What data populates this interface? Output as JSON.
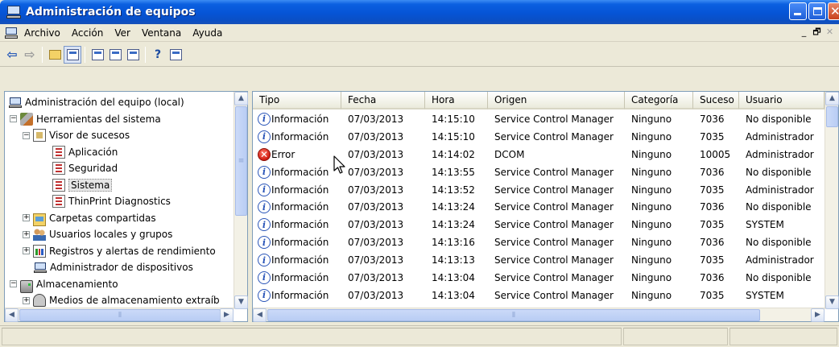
{
  "window": {
    "title": "Administración de equipos"
  },
  "menubar": {
    "items": [
      "Archivo",
      "Acción",
      "Ver",
      "Ventana",
      "Ayuda"
    ],
    "mdi_min": "_",
    "mdi_restore": "🗗",
    "mdi_close": "✕"
  },
  "toolbar": {
    "buttons": [
      "back-arrow-icon",
      "forward-arrow-icon",
      "up-folder-icon",
      "show-hide-tree-icon",
      "properties-icon",
      "refresh-icon",
      "export-list-icon",
      "help-icon",
      "show-hide-action-pane-icon"
    ]
  },
  "tree": {
    "items": [
      {
        "label": "Administración del equipo (local)",
        "icon": "computer-icon",
        "level": 0
      },
      {
        "label": "Herramientas del sistema",
        "icon": "system-tools-icon",
        "level": 1,
        "expander": "−"
      },
      {
        "label": "Visor de sucesos",
        "icon": "event-viewer-icon",
        "level": 2,
        "expander": "−"
      },
      {
        "label": "Aplicación",
        "icon": "event-log-icon",
        "level": 3
      },
      {
        "label": "Seguridad",
        "icon": "event-log-icon",
        "level": 3
      },
      {
        "label": "Sistema",
        "icon": "event-log-icon",
        "level": 3,
        "selected": true
      },
      {
        "label": "ThinPrint Diagnostics",
        "icon": "event-log-icon",
        "level": 3
      },
      {
        "label": "Carpetas compartidas",
        "icon": "shared-folder-icon",
        "level": 2,
        "expander": "+"
      },
      {
        "label": "Usuarios locales y grupos",
        "icon": "users-groups-icon",
        "level": 2,
        "expander": "+"
      },
      {
        "label": "Registros y alertas de rendimiento",
        "icon": "performance-icon",
        "level": 2,
        "expander": "+"
      },
      {
        "label": "Administrador de dispositivos",
        "icon": "device-manager-icon",
        "level": 2
      },
      {
        "label": "Almacenamiento",
        "icon": "storage-icon",
        "level": 1,
        "expander": "−"
      },
      {
        "label": "Medios de almacenamiento extraíb",
        "icon": "removable-storage-icon",
        "level": 2,
        "expander": "+"
      }
    ]
  },
  "events": {
    "columns": [
      "Tipo",
      "Fecha",
      "Hora",
      "Origen",
      "Categoría",
      "Suceso",
      "Usuario"
    ],
    "rows": [
      {
        "tipo": "Información",
        "level": "info",
        "fecha": "07/03/2013",
        "hora": "14:15:10",
        "origen": "Service Control Manager",
        "categoria": "Ninguno",
        "suceso": "7036",
        "usuario": "No disponible"
      },
      {
        "tipo": "Información",
        "level": "info",
        "fecha": "07/03/2013",
        "hora": "14:15:10",
        "origen": "Service Control Manager",
        "categoria": "Ninguno",
        "suceso": "7035",
        "usuario": "Administrador"
      },
      {
        "tipo": "Error",
        "level": "error",
        "fecha": "07/03/2013",
        "hora": "14:14:02",
        "origen": "DCOM",
        "categoria": "Ninguno",
        "suceso": "10005",
        "usuario": "Administrador"
      },
      {
        "tipo": "Información",
        "level": "info",
        "fecha": "07/03/2013",
        "hora": "14:13:55",
        "origen": "Service Control Manager",
        "categoria": "Ninguno",
        "suceso": "7036",
        "usuario": "No disponible"
      },
      {
        "tipo": "Información",
        "level": "info",
        "fecha": "07/03/2013",
        "hora": "14:13:52",
        "origen": "Service Control Manager",
        "categoria": "Ninguno",
        "suceso": "7035",
        "usuario": "Administrador"
      },
      {
        "tipo": "Información",
        "level": "info",
        "fecha": "07/03/2013",
        "hora": "14:13:24",
        "origen": "Service Control Manager",
        "categoria": "Ninguno",
        "suceso": "7036",
        "usuario": "No disponible"
      },
      {
        "tipo": "Información",
        "level": "info",
        "fecha": "07/03/2013",
        "hora": "14:13:24",
        "origen": "Service Control Manager",
        "categoria": "Ninguno",
        "suceso": "7035",
        "usuario": "SYSTEM"
      },
      {
        "tipo": "Información",
        "level": "info",
        "fecha": "07/03/2013",
        "hora": "14:13:16",
        "origen": "Service Control Manager",
        "categoria": "Ninguno",
        "suceso": "7036",
        "usuario": "No disponible"
      },
      {
        "tipo": "Información",
        "level": "info",
        "fecha": "07/03/2013",
        "hora": "14:13:13",
        "origen": "Service Control Manager",
        "categoria": "Ninguno",
        "suceso": "7035",
        "usuario": "Administrador"
      },
      {
        "tipo": "Información",
        "level": "info",
        "fecha": "07/03/2013",
        "hora": "14:13:04",
        "origen": "Service Control Manager",
        "categoria": "Ninguno",
        "suceso": "7036",
        "usuario": "No disponible"
      },
      {
        "tipo": "Información",
        "level": "info",
        "fecha": "07/03/2013",
        "hora": "14:13:04",
        "origen": "Service Control Manager",
        "categoria": "Ninguno",
        "suceso": "7035",
        "usuario": "SYSTEM"
      }
    ]
  },
  "statusbar": {
    "text": ""
  },
  "colors": {
    "titlebar": "#0654d6",
    "panel_border": "#7f9db9",
    "info_icon": "#2a55b8",
    "error_icon": "#d01c10"
  }
}
